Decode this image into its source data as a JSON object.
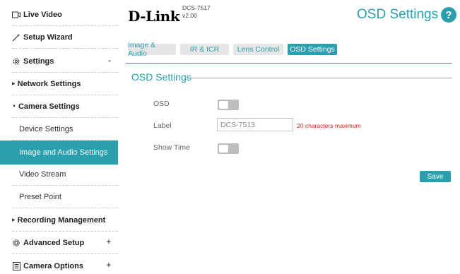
{
  "sidebar": {
    "live_video": "Live Video",
    "setup_wizard": "Setup Wizard",
    "settings": "Settings",
    "settings_sign": "-",
    "network_settings": "Network Settings",
    "camera_settings": "Camera Settings",
    "device_settings": "Device Settings",
    "image_audio_settings": "Image and Audio Settings",
    "video_stream": "Video Stream",
    "preset_point": "Preset Point",
    "recording_management": "Recording Management",
    "advanced_setup": "Advanced Setup",
    "advanced_sign": "+",
    "camera_options": "Camera Options",
    "camera_options_sign": "+"
  },
  "header": {
    "logo": "D-Link",
    "model": "DCS-7517",
    "version": "v2.00",
    "page_title": "OSD Settings",
    "help": "?"
  },
  "tabs": [
    "Image & Audio",
    "IR & ICR",
    "Lens Control",
    "OSD Settings"
  ],
  "osd": {
    "section_title": "OSD Settings",
    "osd_label": "OSD",
    "osd_enabled": false,
    "label_label": "Label",
    "label_value": "DCS-7513",
    "label_hint": "20 characters maximum",
    "show_time_label": "Show Time",
    "show_time_enabled": false,
    "save": "Save"
  },
  "colors": {
    "accent": "#2a9fad",
    "warning": "#d9251d",
    "toggle_off": "#bdbdbd"
  }
}
